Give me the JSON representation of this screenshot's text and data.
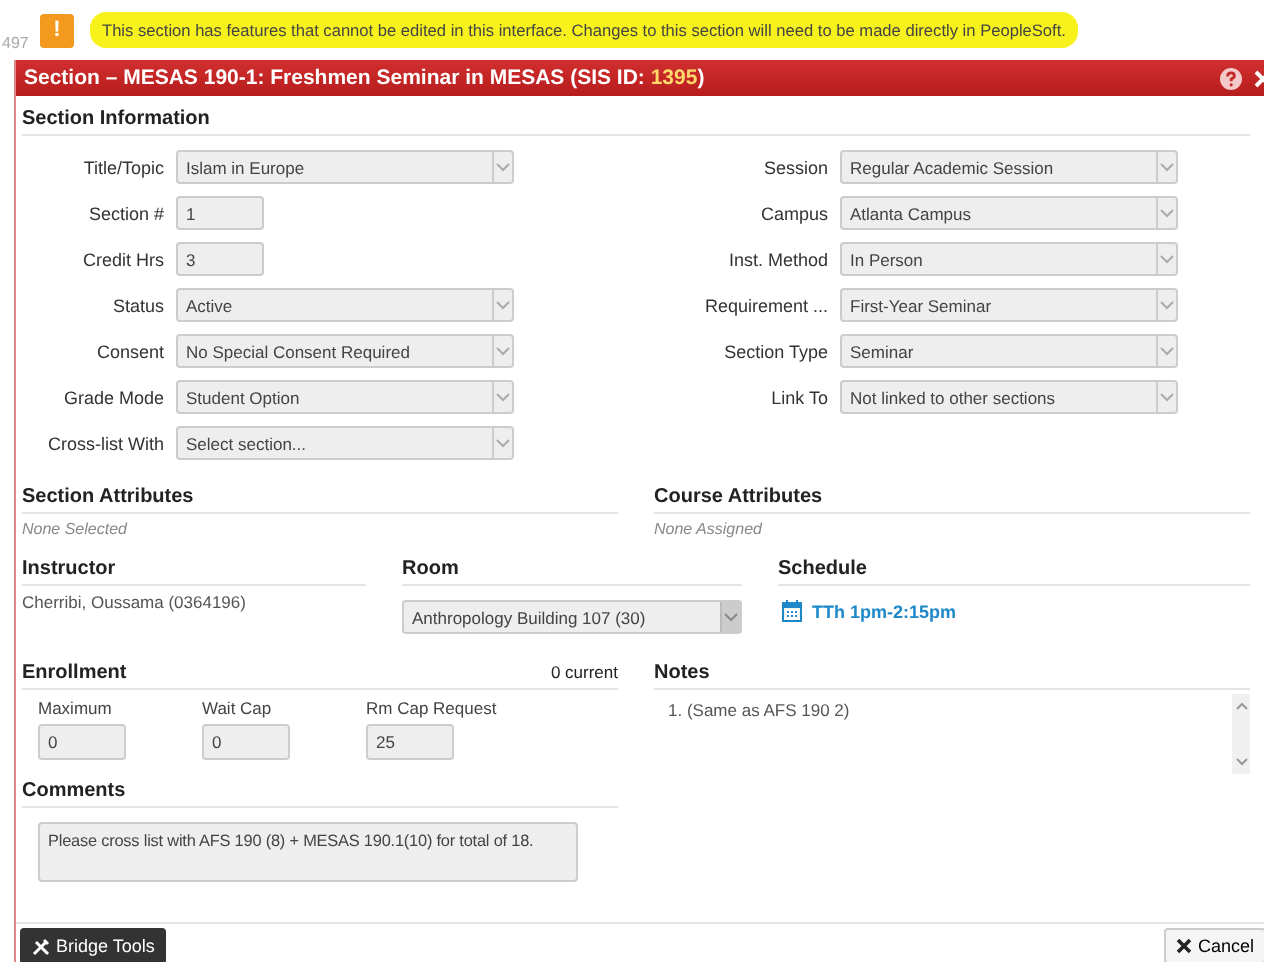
{
  "page_behind": {
    "text": "497"
  },
  "notice": {
    "icon": "!",
    "text": "This section has features that cannot be edited in this interface. Changes to this section will need to be made directly in PeopleSoft."
  },
  "window": {
    "title": "Section – MESAS 190-1: Freshmen Seminar in MESAS (SIS ID: ",
    "sis_id": "1395",
    "title_end": ")"
  },
  "section_information": {
    "heading": "Section Information",
    "left_fields": [
      {
        "label": "Title/Topic",
        "kind": "select",
        "value": "Islam in Europe"
      },
      {
        "label": "Section #",
        "kind": "text",
        "value": "1"
      },
      {
        "label": "Credit Hrs",
        "kind": "text",
        "value": "3"
      },
      {
        "label": "Status",
        "kind": "select",
        "value": "Active"
      },
      {
        "label": "Consent",
        "kind": "select",
        "value": "No Special Consent Required"
      },
      {
        "label": "Grade Mode",
        "kind": "select",
        "value": "Student Option"
      },
      {
        "label": "Cross-list With",
        "kind": "select",
        "placeholder": "Select section..."
      }
    ],
    "right_fields": [
      {
        "label": "Session",
        "kind": "select",
        "value": "Regular Academic Session"
      },
      {
        "label": "Campus",
        "kind": "select",
        "value": "Atlanta Campus"
      },
      {
        "label": "Inst. Method",
        "kind": "select",
        "value": "In Person"
      },
      {
        "label": "Requirement ...",
        "kind": "select",
        "value": "First-Year Seminar"
      },
      {
        "label": "Section Type",
        "kind": "select",
        "value": "Seminar"
      },
      {
        "label": "Link To",
        "kind": "select",
        "value": "Not linked to other sections"
      }
    ]
  },
  "section_attributes": {
    "heading": "Section Attributes",
    "text": "None Selected"
  },
  "course_attributes": {
    "heading": "Course Attributes",
    "text": "None Assigned"
  },
  "instructor": {
    "heading": "Instructor",
    "text": "Cherribi, Oussama (0364196)"
  },
  "room": {
    "heading": "Room",
    "value": "Anthropology Building 107 (30)"
  },
  "schedule": {
    "heading": "Schedule",
    "link": "TTh 1pm-2:15pm"
  },
  "enrollment": {
    "heading": "Enrollment",
    "current": "0 current",
    "fields": [
      {
        "label": "Maximum",
        "value": "0"
      },
      {
        "label": "Wait Cap",
        "value": "0"
      },
      {
        "label": "Rm Cap Request",
        "value": "25"
      }
    ]
  },
  "notes": {
    "heading": "Notes",
    "items": [
      "1. (Same as AFS 190 2)"
    ]
  },
  "comments": {
    "heading": "Comments",
    "value": "Please cross list with AFS 190 (8) + MESAS 190.1(10) for total of 18."
  },
  "footer": {
    "left_button": "Bridge Tools",
    "right_button": "Cancel"
  }
}
